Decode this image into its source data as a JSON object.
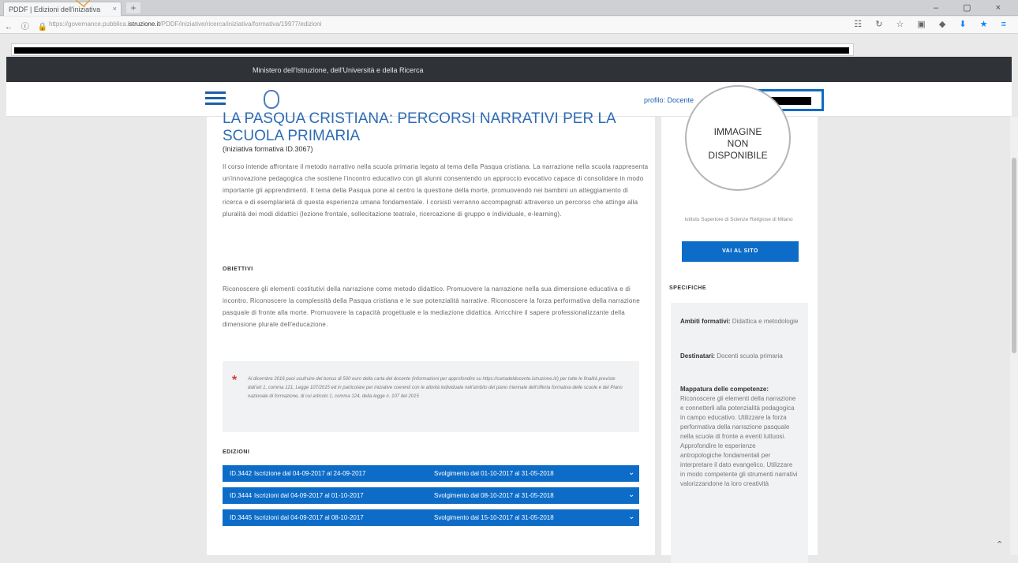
{
  "browser": {
    "tab_title": "PDDF | Edizioni dell'iniziativa",
    "tab_close": "×",
    "new_tab": "+",
    "window_controls": "– ▢ ×",
    "nav_buttons": "← ⓘ 🔒",
    "url_prefix": "https://governance.pubblica.",
    "url_domain": "istruzione.it",
    "url_suffix": "/PDDF/iniziative/ricerca/iniziativa/formativa/19977/edizioni",
    "toolbar_icons": "☷ ↻ ☆ ▣ ◆",
    "toolbar_icons_accent": "⬇ ★ ≡"
  },
  "site": {
    "ministry": "Ministero dell'Istruzione, dell'Università e della Ricerca",
    "profile": "profilo: Docente"
  },
  "main": {
    "title": "LA PASQUA CRISTIANA: PERCORSI NARRATIVI PER LA SCUOLA PRIMARIA",
    "subtitle": "(Iniziativa formativa ID.3067)",
    "description": "Il corso intende affrontare il metodo narrativo nella scuola primaria legato al tema della Pasqua cristiana. La narrazione nella scuola rappresenta un'innovazione pedagogica che sostiene l'incontro educativo con gli alunni consentendo un approccio evocativo capace di consolidare in modo importante gli apprendimenti. Il tema della Pasqua pone al centro la questione della morte, promuovendo nei bambini un atteggiamento di ricerca e di esemplarietà di questa esperienza umana fondamentale. I corsisti verranno accompagnati attraverso un percorso che attinge alla pluralità dei modi didattici (lezione frontale, sollecitazione teatrale, ricercazione di gruppo e individuale, e-learning).",
    "objectives_heading": "OBIETTIVI",
    "objectives": "Riconoscere gli elementi costitutivi della narrazione come metodo didattico. Promuovere la narrazione nella sua dimensione educativa e di incontro. Riconoscere la complessità della Pasqua cristiana e le sue potenzialità narrative. Riconoscere la forza performativa della narrazione pasquale di fronte alla morte. Promuovere la capacità progettuale e la mediazione didattica. Arricchire il sapere professionalizzante della dimensione plurale dell'educazione.",
    "note_star": "*",
    "note": "Al dicembre 2016 puoi usufruire del bonus di 500 euro della carta del docente (informazioni per approfondire su https://cartadeldocente.istruzione.it/) per tutte le finalità previste dall'art 1, comma 121, Legge 107/2015 ed in particolare per iniziative coerenti con le attività individuate nell'ambito del piano triennale dell'offerta formativa delle scuole e del Piano nazionale di formazione, di cui articolo 1, comma 124, della legge n. 107 del 2015",
    "editions_heading": "EDIZIONI",
    "editions": [
      {
        "id": "ID.3442",
        "iscrizioni": "Iscrizione dal 04-09-2017 al 24-09-2017",
        "svolgimento": "Svolgimento dal 01-10-2017 al 31-05-2018",
        "chevron": "⌄"
      },
      {
        "id": "ID.3444",
        "iscrizioni": "Iscrizioni dal 04-09-2017 al 01-10-2017",
        "svolgimento": "Svolgimento dal 08-10-2017 al 31-05-2018",
        "chevron": "⌄"
      },
      {
        "id": "ID.3445",
        "iscrizioni": "Iscrizioni dal 04-09-2017 al 08-10-2017",
        "svolgimento": "Svolgimento dal 15-10-2017 al 31-05-2018",
        "chevron": "⌄"
      }
    ]
  },
  "sidebar": {
    "image_l1": "IMMAGINE",
    "image_l2": "NON",
    "image_l3": "DISPONIBILE",
    "institute": "Istituto Superiore di Scienze Religiose di Milano",
    "site_button": "VAI AL SITO",
    "specs_heading": "SPECIFICHE",
    "ambiti_label": "Ambiti formativi:",
    "ambiti_value": "Didattica e metodologie",
    "destinatari_label": "Destinatari:",
    "destinatari_value": "Docenti scuola primaria",
    "mappatura_label": "Mappatura delle competenze:",
    "mappatura_value": "Riconoscere gli elementi della narrazione e connetterli alla potenzialità pedagogica in campo educativo. Utilizzare la forza performativa della narrazione pasquale nella scuola di fronte a eventi luttuosi. Approfondire le esperienze antropologiche fondamentali per interpretare il dato evangelico. Utilizzare in modo competente gli strumenti narrativi valorizzandone la loro creatività"
  },
  "page": {
    "back_to_top": "⌃"
  },
  "colors": {
    "accent": "#0d6cc7",
    "header_dark": "#2f3237",
    "title_blue": "#2d6bb4",
    "note_star": "#d23c3c"
  }
}
